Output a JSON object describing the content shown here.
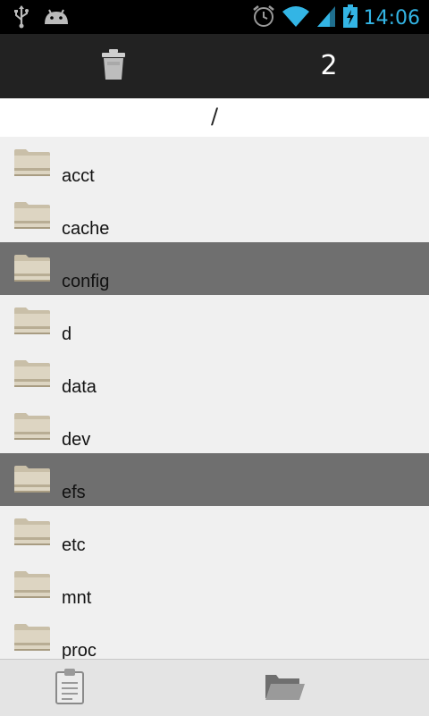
{
  "status_bar": {
    "time": "14:06",
    "icons": [
      "usb-icon",
      "android-icon",
      "alarm-icon",
      "wifi-icon",
      "signal-icon",
      "battery-charging-icon"
    ],
    "accent_color": "#33b5e5"
  },
  "action_bar": {
    "trash_icon": "trash-icon",
    "selected_count": "2"
  },
  "path": "/",
  "files": [
    {
      "name": "acct",
      "selected": false
    },
    {
      "name": "cache",
      "selected": false
    },
    {
      "name": "config",
      "selected": true
    },
    {
      "name": "d",
      "selected": false
    },
    {
      "name": "data",
      "selected": false
    },
    {
      "name": "dev",
      "selected": false
    },
    {
      "name": "efs",
      "selected": true
    },
    {
      "name": "etc",
      "selected": false
    },
    {
      "name": "mnt",
      "selected": false
    },
    {
      "name": "proc",
      "selected": false
    }
  ],
  "colors": {
    "selected_row": "#6f6f6f",
    "action_bar": "#222222",
    "list_bg": "#f0f0f0"
  },
  "bottom_bar": {
    "left_icon": "clipboard-icon",
    "right_icon": "folder-open-icon"
  }
}
